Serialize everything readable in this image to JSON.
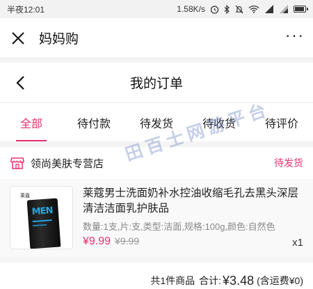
{
  "status_bar": {
    "time": "半夜12:01",
    "net_speed": "1.58K/s",
    "icons": [
      "alarm-icon",
      "bluetooth-icon",
      "mute-icon",
      "wifi-icon",
      "signal-icon",
      "signal-icon",
      "battery-icon"
    ],
    "battery_level": 0.95
  },
  "app_header": {
    "title": "妈妈购",
    "close_icon": "close-icon",
    "more_icon": "more-icon",
    "more_label": "···"
  },
  "page_header": {
    "title": "我的订单",
    "back_icon": "chevron-left-icon"
  },
  "tabs": [
    {
      "label": "全部",
      "active": true
    },
    {
      "label": "待付款",
      "active": false
    },
    {
      "label": "待发货",
      "active": false
    },
    {
      "label": "待收货",
      "active": false
    },
    {
      "label": "待评价",
      "active": false
    }
  ],
  "order": {
    "shop": {
      "icon": "store-icon",
      "name": "领尚美肤专营店",
      "status": "待发货"
    },
    "product": {
      "thumb_brand": "莱蔻",
      "thumb_label": "MEN",
      "title": "莱蔻男士洗面奶补水控油收缩毛孔去黑头深层清洁洁面乳护肤品",
      "spec": "数量:1支,片:支,类型:洁面,规格:100g,颜色:自然色",
      "price": "¥9.99",
      "original_price": "¥9.99",
      "quantity": "x1"
    },
    "summary": {
      "count_text": "共1件商品",
      "total_label": "合计:",
      "total_amount": "¥3.48",
      "shipping_text": "(含运费¥0)"
    }
  },
  "watermark": "田百士网游平台",
  "colors": {
    "accent": "#e8336d",
    "background": "#f4f4f4",
    "card": "#ffffff"
  }
}
